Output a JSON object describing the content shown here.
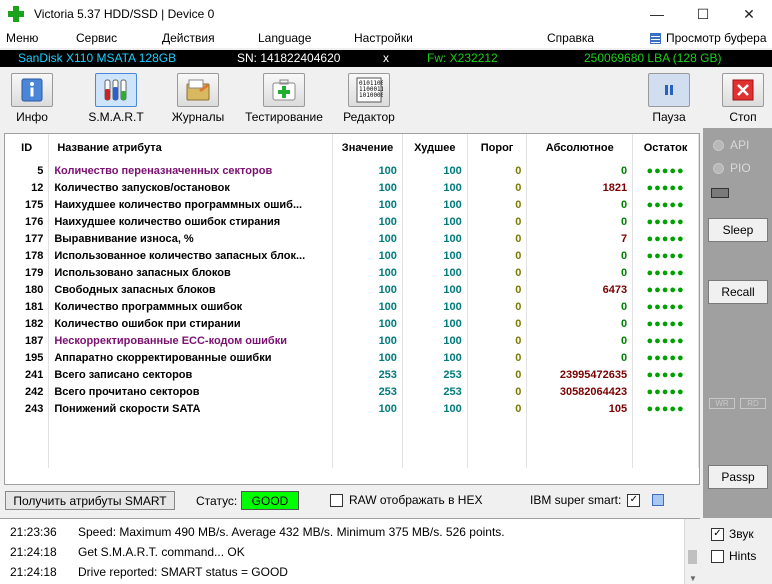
{
  "window": {
    "title": "Victoria 5.37 HDD/SSD | Device 0"
  },
  "menu": {
    "items": [
      "Меню",
      "Сервис",
      "Действия",
      "Language",
      "Настройки",
      "Справка"
    ],
    "buffer_view": "Просмотр буфера"
  },
  "device": {
    "model": "SanDisk X110 MSATA 128GB",
    "serial": "SN: 141822404620",
    "close": "x",
    "firmware": "Fw: X232212",
    "lba": "250069680 LBA (128 GB)"
  },
  "toolbar": {
    "info": "Инфо",
    "smart": "S.M.A.R.T",
    "logs": "Журналы",
    "test": "Тестирование",
    "editor": "Редактор",
    "pause": "Пауза",
    "stop": "Стоп"
  },
  "table": {
    "headers": {
      "id": "ID",
      "name": "Название атрибута",
      "value": "Значение",
      "worst": "Худшее",
      "threshold": "Порог",
      "absolute": "Абсолютное",
      "rest": "Остаток"
    },
    "rows": [
      {
        "id": "5",
        "name": "Количество переназначенных секторов",
        "value": "100",
        "worst": "100",
        "threshold": "0",
        "absolute": "0",
        "rest": "●●●●●",
        "highlight": true
      },
      {
        "id": "12",
        "name": "Количество запусков/остановок",
        "value": "100",
        "worst": "100",
        "threshold": "0",
        "absolute": "1821",
        "rest": "●●●●●",
        "highlight": false
      },
      {
        "id": "175",
        "name": "Наихудшее количество программных ошиб...",
        "value": "100",
        "worst": "100",
        "threshold": "0",
        "absolute": "0",
        "rest": "●●●●●",
        "highlight": false
      },
      {
        "id": "176",
        "name": "Наихудшее количество ошибок стирания",
        "value": "100",
        "worst": "100",
        "threshold": "0",
        "absolute": "0",
        "rest": "●●●●●",
        "highlight": false
      },
      {
        "id": "177",
        "name": "Выравнивание износа, %",
        "value": "100",
        "worst": "100",
        "threshold": "0",
        "absolute": "7",
        "rest": "●●●●●",
        "highlight": false
      },
      {
        "id": "178",
        "name": "Использованное количество запасных блок...",
        "value": "100",
        "worst": "100",
        "threshold": "0",
        "absolute": "0",
        "rest": "●●●●●",
        "highlight": false
      },
      {
        "id": "179",
        "name": "Использовано запасных блоков",
        "value": "100",
        "worst": "100",
        "threshold": "0",
        "absolute": "0",
        "rest": "●●●●●",
        "highlight": false
      },
      {
        "id": "180",
        "name": "Свободных запасных блоков",
        "value": "100",
        "worst": "100",
        "threshold": "0",
        "absolute": "6473",
        "rest": "●●●●●",
        "highlight": false
      },
      {
        "id": "181",
        "name": "Количество программных ошибок",
        "value": "100",
        "worst": "100",
        "threshold": "0",
        "absolute": "0",
        "rest": "●●●●●",
        "highlight": false
      },
      {
        "id": "182",
        "name": "Количество ошибок при стирании",
        "value": "100",
        "worst": "100",
        "threshold": "0",
        "absolute": "0",
        "rest": "●●●●●",
        "highlight": false
      },
      {
        "id": "187",
        "name": "Нескорректированные ECC-кодом ошибки",
        "value": "100",
        "worst": "100",
        "threshold": "0",
        "absolute": "0",
        "rest": "●●●●●",
        "highlight": true
      },
      {
        "id": "195",
        "name": "Аппаратно скорректированные ошибки",
        "value": "100",
        "worst": "100",
        "threshold": "0",
        "absolute": "0",
        "rest": "●●●●●",
        "highlight": false
      },
      {
        "id": "241",
        "name": "Всего записано секторов",
        "value": "253",
        "worst": "253",
        "threshold": "0",
        "absolute": "23995472635",
        "rest": "●●●●●",
        "highlight": false
      },
      {
        "id": "242",
        "name": "Всего прочитано секторов",
        "value": "253",
        "worst": "253",
        "threshold": "0",
        "absolute": "30582064423",
        "rest": "●●●●●",
        "highlight": false
      },
      {
        "id": "243",
        "name": "Понижений скорости SATA",
        "value": "100",
        "worst": "100",
        "threshold": "0",
        "absolute": "105",
        "rest": "●●●●●",
        "highlight": false
      }
    ]
  },
  "side": {
    "api": "API",
    "pio": "PIO",
    "sleep": "Sleep",
    "recall": "Recall",
    "passp": "Passp",
    "wr": "WR",
    "rd": "RD"
  },
  "status": {
    "get_smart": "Получить атрибуты SMART",
    "status_label": "Статус:",
    "status_value": "GOOD",
    "status_color": "#00ff00",
    "raw_hex": "RAW отображать в HEX",
    "ibm_smart": "IBM super smart:"
  },
  "log": [
    {
      "time": "21:23:36",
      "msg": "Speed: Maximum 490 MB/s. Average 432 MB/s. Minimum 375 MB/s. 526 points."
    },
    {
      "time": "21:24:18",
      "msg": "Get S.M.A.R.T. command... OK"
    },
    {
      "time": "21:24:18",
      "msg": "Drive reported: SMART status = GOOD"
    }
  ],
  "options": {
    "sound": "Звук",
    "hints": "Hints",
    "sound_checked": true,
    "hints_checked": false
  }
}
